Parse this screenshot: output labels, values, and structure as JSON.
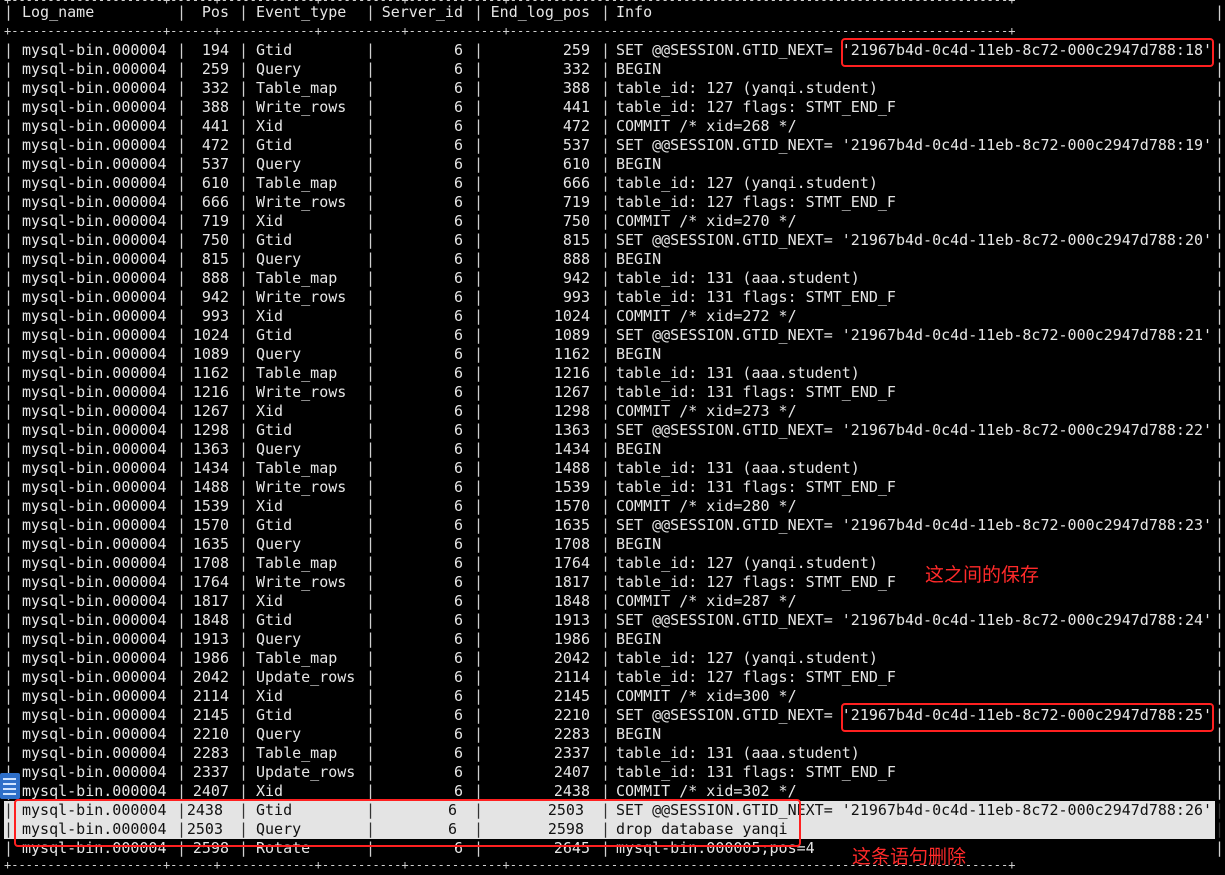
{
  "terminal": {
    "border_line": "+---------------------+------+-------------+-----------+-------------+---------------------------------------------------------------------+",
    "headers": [
      "Log_name",
      "Pos",
      "Event_type",
      "Server_id",
      "End_log_pos",
      "Info"
    ],
    "rows": [
      [
        "mysql-bin.000004",
        "194",
        "Gtid",
        "6",
        "259",
        "SET @@SESSION.GTID_NEXT= '21967b4d-0c4d-11eb-8c72-000c2947d788:18'"
      ],
      [
        "mysql-bin.000004",
        "259",
        "Query",
        "6",
        "332",
        "BEGIN"
      ],
      [
        "mysql-bin.000004",
        "332",
        "Table_map",
        "6",
        "388",
        "table_id: 127 (yanqi.student)"
      ],
      [
        "mysql-bin.000004",
        "388",
        "Write_rows",
        "6",
        "441",
        "table_id: 127 flags: STMT_END_F"
      ],
      [
        "mysql-bin.000004",
        "441",
        "Xid",
        "6",
        "472",
        "COMMIT /* xid=268 */"
      ],
      [
        "mysql-bin.000004",
        "472",
        "Gtid",
        "6",
        "537",
        "SET @@SESSION.GTID_NEXT= '21967b4d-0c4d-11eb-8c72-000c2947d788:19'"
      ],
      [
        "mysql-bin.000004",
        "537",
        "Query",
        "6",
        "610",
        "BEGIN"
      ],
      [
        "mysql-bin.000004",
        "610",
        "Table_map",
        "6",
        "666",
        "table_id: 127 (yanqi.student)"
      ],
      [
        "mysql-bin.000004",
        "666",
        "Write_rows",
        "6",
        "719",
        "table_id: 127 flags: STMT_END_F"
      ],
      [
        "mysql-bin.000004",
        "719",
        "Xid",
        "6",
        "750",
        "COMMIT /* xid=270 */"
      ],
      [
        "mysql-bin.000004",
        "750",
        "Gtid",
        "6",
        "815",
        "SET @@SESSION.GTID_NEXT= '21967b4d-0c4d-11eb-8c72-000c2947d788:20'"
      ],
      [
        "mysql-bin.000004",
        "815",
        "Query",
        "6",
        "888",
        "BEGIN"
      ],
      [
        "mysql-bin.000004",
        "888",
        "Table_map",
        "6",
        "942",
        "table_id: 131 (aaa.student)"
      ],
      [
        "mysql-bin.000004",
        "942",
        "Write_rows",
        "6",
        "993",
        "table_id: 131 flags: STMT_END_F"
      ],
      [
        "mysql-bin.000004",
        "993",
        "Xid",
        "6",
        "1024",
        "COMMIT /* xid=272 */"
      ],
      [
        "mysql-bin.000004",
        "1024",
        "Gtid",
        "6",
        "1089",
        "SET @@SESSION.GTID_NEXT= '21967b4d-0c4d-11eb-8c72-000c2947d788:21'"
      ],
      [
        "mysql-bin.000004",
        "1089",
        "Query",
        "6",
        "1162",
        "BEGIN"
      ],
      [
        "mysql-bin.000004",
        "1162",
        "Table_map",
        "6",
        "1216",
        "table_id: 131 (aaa.student)"
      ],
      [
        "mysql-bin.000004",
        "1216",
        "Write_rows",
        "6",
        "1267",
        "table_id: 131 flags: STMT_END_F"
      ],
      [
        "mysql-bin.000004",
        "1267",
        "Xid",
        "6",
        "1298",
        "COMMIT /* xid=273 */"
      ],
      [
        "mysql-bin.000004",
        "1298",
        "Gtid",
        "6",
        "1363",
        "SET @@SESSION.GTID_NEXT= '21967b4d-0c4d-11eb-8c72-000c2947d788:22'"
      ],
      [
        "mysql-bin.000004",
        "1363",
        "Query",
        "6",
        "1434",
        "BEGIN"
      ],
      [
        "mysql-bin.000004",
        "1434",
        "Table_map",
        "6",
        "1488",
        "table_id: 131 (aaa.student)"
      ],
      [
        "mysql-bin.000004",
        "1488",
        "Write_rows",
        "6",
        "1539",
        "table_id: 131 flags: STMT_END_F"
      ],
      [
        "mysql-bin.000004",
        "1539",
        "Xid",
        "6",
        "1570",
        "COMMIT /* xid=280 */"
      ],
      [
        "mysql-bin.000004",
        "1570",
        "Gtid",
        "6",
        "1635",
        "SET @@SESSION.GTID_NEXT= '21967b4d-0c4d-11eb-8c72-000c2947d788:23'"
      ],
      [
        "mysql-bin.000004",
        "1635",
        "Query",
        "6",
        "1708",
        "BEGIN"
      ],
      [
        "mysql-bin.000004",
        "1708",
        "Table_map",
        "6",
        "1764",
        "table_id: 127 (yanqi.student)"
      ],
      [
        "mysql-bin.000004",
        "1764",
        "Write_rows",
        "6",
        "1817",
        "table_id: 127 flags: STMT_END_F"
      ],
      [
        "mysql-bin.000004",
        "1817",
        "Xid",
        "6",
        "1848",
        "COMMIT /* xid=287 */"
      ],
      [
        "mysql-bin.000004",
        "1848",
        "Gtid",
        "6",
        "1913",
        "SET @@SESSION.GTID_NEXT= '21967b4d-0c4d-11eb-8c72-000c2947d788:24'"
      ],
      [
        "mysql-bin.000004",
        "1913",
        "Query",
        "6",
        "1986",
        "BEGIN"
      ],
      [
        "mysql-bin.000004",
        "1986",
        "Table_map",
        "6",
        "2042",
        "table_id: 127 (yanqi.student)"
      ],
      [
        "mysql-bin.000004",
        "2042",
        "Update_rows",
        "6",
        "2114",
        "table_id: 127 flags: STMT_END_F"
      ],
      [
        "mysql-bin.000004",
        "2114",
        "Xid",
        "6",
        "2145",
        "COMMIT /* xid=300 */"
      ],
      [
        "mysql-bin.000004",
        "2145",
        "Gtid",
        "6",
        "2210",
        "SET @@SESSION.GTID_NEXT= '21967b4d-0c4d-11eb-8c72-000c2947d788:25'"
      ],
      [
        "mysql-bin.000004",
        "2210",
        "Query",
        "6",
        "2283",
        "BEGIN"
      ],
      [
        "mysql-bin.000004",
        "2283",
        "Table_map",
        "6",
        "2337",
        "table_id: 131 (aaa.student)"
      ],
      [
        "mysql-bin.000004",
        "2337",
        "Update_rows",
        "6",
        "2407",
        "table_id: 131 flags: STMT_END_F"
      ],
      [
        "mysql-bin.000004",
        "2407",
        "Xid",
        "6",
        "2438",
        "COMMIT /* xid=302 */"
      ],
      [
        "mysql-bin.000004",
        "2438",
        "Gtid",
        "6",
        "2503",
        "SET @@SESSION.GTID_NEXT= '21967b4d-0c4d-11eb-8c72-000c2947d788:26'"
      ],
      [
        "mysql-bin.000004",
        "2503",
        "Query",
        "6",
        "2598",
        "drop database yanqi"
      ],
      [
        "mysql-bin.000004",
        "2598",
        "Rotate",
        "6",
        "2645",
        "mysql-bin.000005;pos=4"
      ]
    ],
    "highlighted_rows": [
      40,
      41
    ]
  },
  "annotations": {
    "save_between": "这之间的保存",
    "delete_statement": "这条语句删除",
    "color": "#ff2020"
  },
  "sidebar_icon": "document-list-icon"
}
